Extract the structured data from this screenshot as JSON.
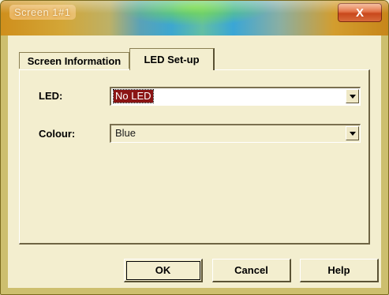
{
  "window": {
    "title": "Screen 1#1",
    "close_glyph": "X",
    "close_icon": "close-icon"
  },
  "tabs": [
    {
      "label": "Screen Information",
      "active": false
    },
    {
      "label": "LED Set-up",
      "active": true
    }
  ],
  "form": {
    "led": {
      "label": "LED:",
      "value": "No LED"
    },
    "colour": {
      "label": "Colour:",
      "value": "Blue"
    }
  },
  "buttons": {
    "ok": "OK",
    "cancel": "Cancel",
    "help": "Help"
  },
  "colors": {
    "frame": "#cdbf6e",
    "face": "#f3eecf",
    "selection": "#8a1414"
  }
}
